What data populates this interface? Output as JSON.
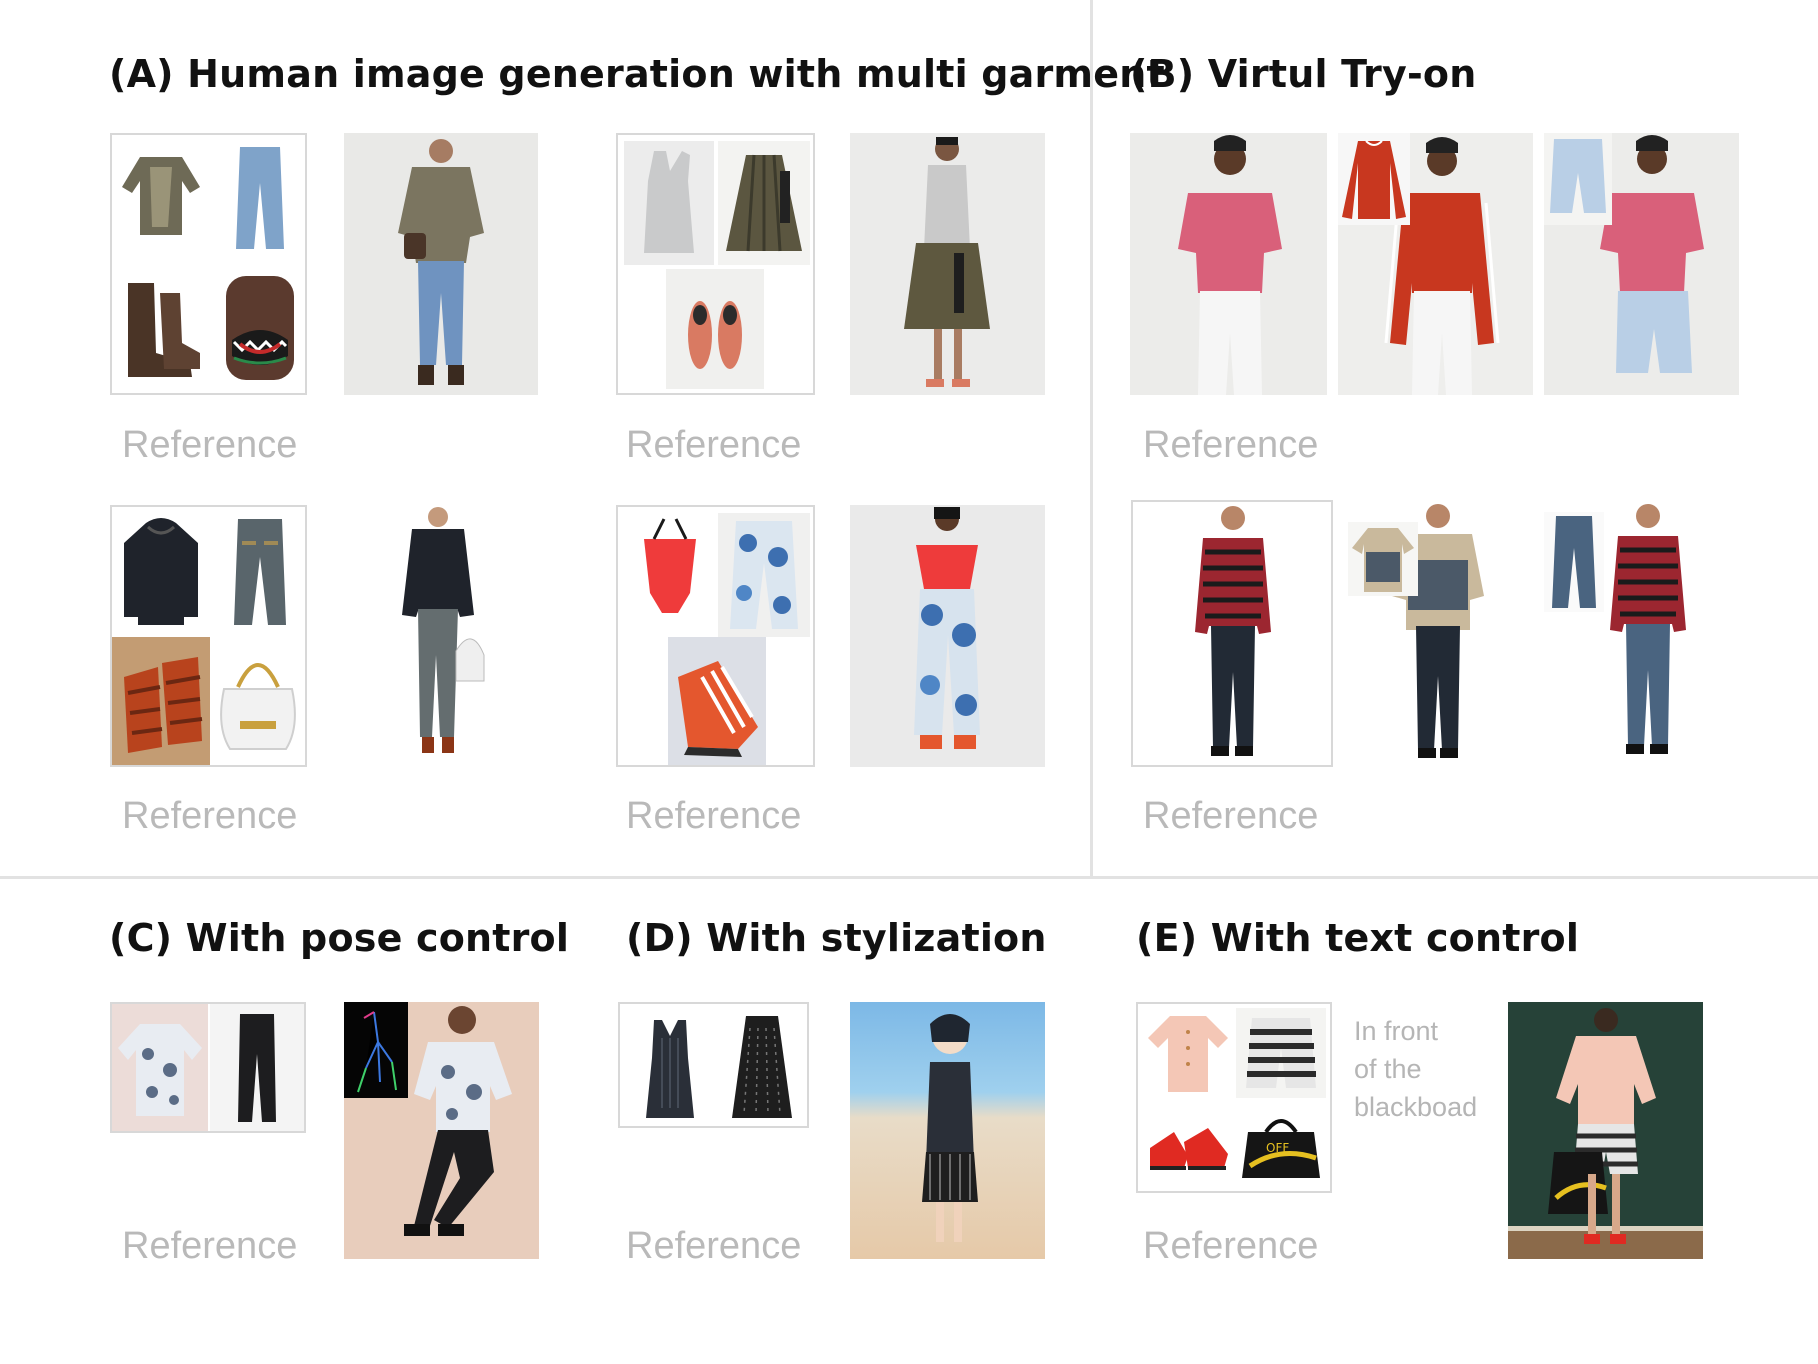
{
  "sections": {
    "a": {
      "title": "(A) Human image generation with multi garment"
    },
    "b": {
      "title": "(B) Virtul Try-on"
    },
    "c": {
      "title": "(C) With pose control"
    },
    "d": {
      "title": "(D) With stylization"
    },
    "e": {
      "title": "(E) With text control"
    }
  },
  "reference_label": "Reference",
  "text_prompt": "In front\nof the\nblackboad",
  "colors": {
    "divider": "#e2e2e2",
    "reference_label": "#b9b9b9",
    "box_border": "#d8d8d8"
  },
  "icons": [
    "metallic-blouse-icon",
    "jeans-icon",
    "boots-icon",
    "shark-backpack-icon",
    "tank-top-icon",
    "plaid-skirt-icon",
    "loafers-icon",
    "hoodie-icon",
    "sandals-icon",
    "handbag-icon",
    "swimsuit-icon",
    "floral-pants-icon",
    "sneaker-icon",
    "red-longsleeve-icon",
    "shorts-icon",
    "printed-shirt-icon",
    "floral-shirt-icon",
    "black-pants-icon",
    "pose-skeleton-icon",
    "black-dress-icon",
    "pleated-skirt-icon",
    "blouse-icon",
    "striped-shorts-icon",
    "red-sneakers-icon",
    "tote-bag-icon"
  ]
}
